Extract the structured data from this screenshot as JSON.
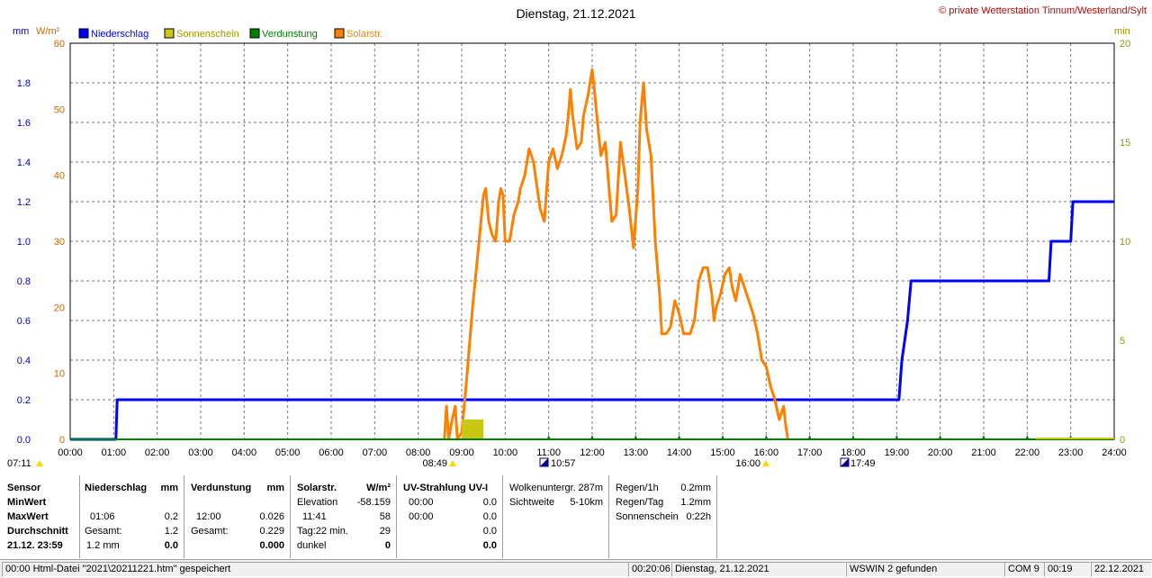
{
  "title": "Dienstag, 21.12.2021",
  "copyright": "© private Wetterstation Tinnum/Westerland/Sylt",
  "units": {
    "left1": "mm",
    "left2": "W/m²",
    "right": "min"
  },
  "legend": [
    {
      "label": "Niederschlag",
      "color": "#0000ff"
    },
    {
      "label": "Sonnenschein",
      "color": "#c8c814"
    },
    {
      "label": "Verdunstung",
      "color": "#008000"
    },
    {
      "label": "Solarstr.",
      "color": "#ff8000"
    }
  ],
  "markers": {
    "sunrise": "07:11",
    "sun_start": "08:49",
    "moon1": "10:57",
    "sun_end": "16:00",
    "moon2": "17:49"
  },
  "chart_data": {
    "type": "line",
    "x_range_hours": [
      0,
      24
    ],
    "x_ticks": [
      "00:00",
      "01:00",
      "02:00",
      "03:00",
      "04:00",
      "05:00",
      "06:00",
      "07:00",
      "08:00",
      "09:00",
      "10:00",
      "11:00",
      "12:00",
      "13:00",
      "14:00",
      "15:00",
      "16:00",
      "17:00",
      "18:00",
      "19:00",
      "20:00",
      "21:00",
      "22:00",
      "23:00",
      "24:00"
    ],
    "axes": {
      "precip_mm": {
        "range": [
          0,
          2.0
        ],
        "ticks": [
          "0.0",
          "0.2",
          "0.4",
          "0.6",
          "0.8",
          "1.0",
          "1.2",
          "1.4",
          "1.6",
          "1.8"
        ]
      },
      "solar_wm2": {
        "range": [
          0,
          60
        ],
        "ticks": [
          "0",
          "10",
          "20",
          "30",
          "40",
          "50",
          "60"
        ]
      },
      "sun_min": {
        "range": [
          0,
          20
        ],
        "ticks": [
          "0",
          "5",
          "10",
          "15",
          "20"
        ]
      }
    },
    "grid": true,
    "series": [
      {
        "name": "Niederschlag",
        "axis": "precip_mm",
        "color": "#0000ff",
        "step": true,
        "points": [
          [
            0,
            0
          ],
          [
            1.05,
            0
          ],
          [
            1.08,
            0.2
          ],
          [
            19.05,
            0.2
          ],
          [
            19.12,
            0.4
          ],
          [
            19.25,
            0.6
          ],
          [
            19.33,
            0.8
          ],
          [
            22.5,
            0.8
          ],
          [
            22.55,
            1.0
          ],
          [
            23.0,
            1.0
          ],
          [
            23.05,
            1.2
          ],
          [
            24,
            1.2
          ]
        ]
      },
      {
        "name": "Solarstr.",
        "axis": "solar_wm2",
        "color": "#ff8000",
        "step": false,
        "points": [
          [
            8.6,
            0
          ],
          [
            8.65,
            5
          ],
          [
            8.7,
            0
          ],
          [
            8.78,
            3
          ],
          [
            8.85,
            5
          ],
          [
            8.9,
            0
          ],
          [
            9.0,
            1
          ],
          [
            9.1,
            8
          ],
          [
            9.25,
            20
          ],
          [
            9.4,
            30
          ],
          [
            9.5,
            37
          ],
          [
            9.55,
            38
          ],
          [
            9.62,
            33
          ],
          [
            9.7,
            31
          ],
          [
            9.78,
            30
          ],
          [
            9.85,
            36
          ],
          [
            9.9,
            38
          ],
          [
            9.95,
            37
          ],
          [
            10.0,
            30
          ],
          [
            10.1,
            30
          ],
          [
            10.2,
            34
          ],
          [
            10.3,
            36
          ],
          [
            10.35,
            38
          ],
          [
            10.45,
            40
          ],
          [
            10.55,
            44
          ],
          [
            10.65,
            42
          ],
          [
            10.8,
            35
          ],
          [
            10.9,
            33
          ],
          [
            11.0,
            42
          ],
          [
            11.1,
            44
          ],
          [
            11.2,
            41
          ],
          [
            11.3,
            43
          ],
          [
            11.4,
            46
          ],
          [
            11.45,
            49
          ],
          [
            11.5,
            53
          ],
          [
            11.55,
            49
          ],
          [
            11.65,
            44
          ],
          [
            11.75,
            45
          ],
          [
            11.8,
            49
          ],
          [
            11.9,
            52
          ],
          [
            12.0,
            56
          ],
          [
            12.05,
            53
          ],
          [
            12.15,
            46
          ],
          [
            12.2,
            43
          ],
          [
            12.3,
            45
          ],
          [
            12.45,
            33
          ],
          [
            12.55,
            34
          ],
          [
            12.65,
            45
          ],
          [
            12.75,
            40
          ],
          [
            12.85,
            35
          ],
          [
            12.95,
            29
          ],
          [
            13.05,
            38
          ],
          [
            13.1,
            48
          ],
          [
            13.18,
            54
          ],
          [
            13.25,
            47
          ],
          [
            13.35,
            43
          ],
          [
            13.45,
            30
          ],
          [
            13.55,
            22
          ],
          [
            13.6,
            16
          ],
          [
            13.7,
            16
          ],
          [
            13.8,
            17
          ],
          [
            13.9,
            21
          ],
          [
            14.0,
            19
          ],
          [
            14.1,
            16
          ],
          [
            14.25,
            16
          ],
          [
            14.35,
            18
          ],
          [
            14.45,
            24
          ],
          [
            14.55,
            26
          ],
          [
            14.65,
            26
          ],
          [
            14.75,
            22
          ],
          [
            14.8,
            18
          ],
          [
            14.85,
            20
          ],
          [
            14.95,
            22
          ],
          [
            15.05,
            25
          ],
          [
            15.15,
            26
          ],
          [
            15.22,
            23
          ],
          [
            15.3,
            21
          ],
          [
            15.4,
            25
          ],
          [
            15.5,
            23
          ],
          [
            15.6,
            21
          ],
          [
            15.7,
            19
          ],
          [
            15.8,
            16
          ],
          [
            15.9,
            12
          ],
          [
            16.0,
            11
          ],
          [
            16.1,
            8
          ],
          [
            16.2,
            6
          ],
          [
            16.3,
            3
          ],
          [
            16.4,
            5
          ],
          [
            16.45,
            2
          ],
          [
            16.5,
            0
          ]
        ]
      },
      {
        "name": "Sonnenschein",
        "axis": "sun_min",
        "color": "#c8c814",
        "bars": [
          {
            "from_hour": 9.0,
            "to_hour": 9.5,
            "value": 1
          }
        ]
      },
      {
        "name": "Verdunstung",
        "axis": "precip_mm",
        "color": "#008000",
        "points": [
          [
            0,
            0
          ],
          [
            24,
            0
          ]
        ]
      }
    ]
  },
  "stats": {
    "labels_col": {
      "sensor": "Sensor",
      "min": "MinWert",
      "max": "MaxWert",
      "avg": "Durchschnitt",
      "date": "21.12. 23:59"
    },
    "precip": {
      "header": "Niederschlag",
      "unit": "mm",
      "max_time": "01:06",
      "max_val": "0.2",
      "total_label": "Gesamt:",
      "total_val": "1.2",
      "avg1": "1.2 mm",
      "avg2": "0.0"
    },
    "evap": {
      "header": "Verdunstung",
      "unit": "mm",
      "max_time": "12:00",
      "max_val": "0.026",
      "total_label": "Gesamt:",
      "total_val": "0.229",
      "avg2": "0.000"
    },
    "solar": {
      "header": "Solarstr.",
      "unit": "W/m²",
      "elev_label": "Elevation",
      "elev_val": "-58.159",
      "max_time": "11:41",
      "max_val": "58",
      "day_label": "Tag:22 min.",
      "day_val": "29",
      "dark_label": "dunkel",
      "dark_val": "0"
    },
    "uv": {
      "header": "UV-Strahlung UV-I",
      "r1_time": "00:00",
      "r1_val": "0.0",
      "r2_time": "00:00",
      "r2_val": "0.0",
      "r3_val": "0.0",
      "r4_val": "0.0"
    },
    "clouds": {
      "base_label": "Wolkenuntergr.",
      "base_val": "287m",
      "vis_label": "Sichtweite",
      "vis_val": "5-10km"
    },
    "rain": {
      "h1_label": "Regen/1h",
      "h1_val": "0.2mm",
      "day_label": "Regen/Tag",
      "day_val": "1.2mm",
      "sun_label": "Sonnenschein",
      "sun_val": "0:22h"
    }
  },
  "statusbar": {
    "left": "00:00  Html-Datei  \"2021\\20211221.htm\"  gespeichert",
    "time": "00:20:06",
    "date": "Dienstag, 21.12.2021",
    "found": "WSWIN 2 gefunden",
    "com": "COM 9",
    "clock": "00:19",
    "today": "22.12.2021"
  }
}
